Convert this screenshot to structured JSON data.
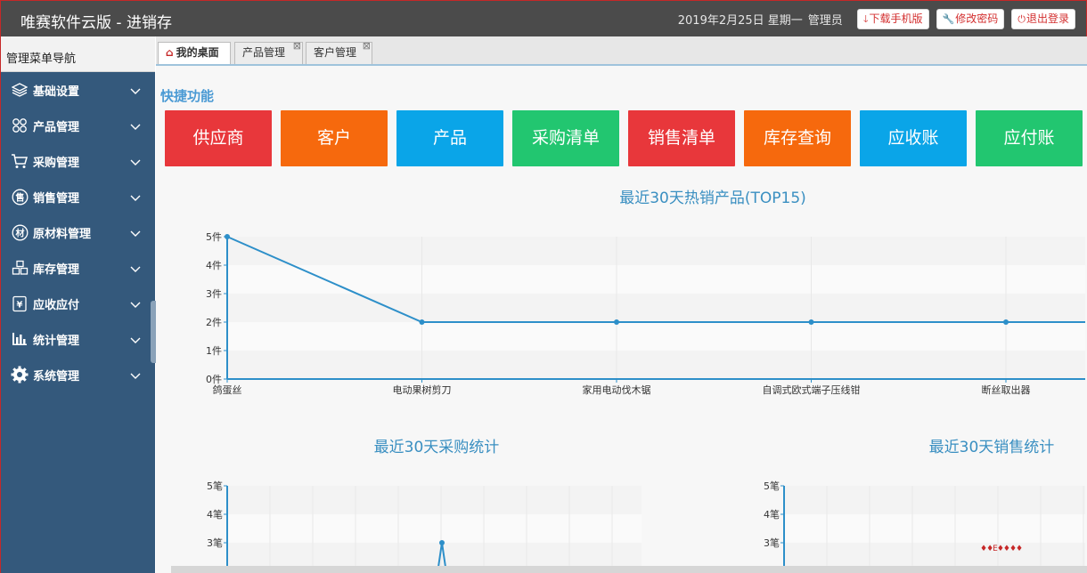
{
  "app": {
    "title": "唯赛软件云版 - 进销存"
  },
  "header": {
    "date": "2019年2月25日 星期一",
    "role": "管理员",
    "buttons": [
      {
        "icon": "download-icon",
        "label": "下载手机版"
      },
      {
        "icon": "wrench-icon",
        "label": "修改密码"
      },
      {
        "icon": "power-icon",
        "label": "退出登录"
      }
    ]
  },
  "sidebar": {
    "title": "管理菜单导航",
    "items": [
      {
        "icon": "layers-icon",
        "label": "基础设置"
      },
      {
        "icon": "grid-icon",
        "label": "产品管理"
      },
      {
        "icon": "cart-icon",
        "label": "采购管理"
      },
      {
        "icon": "sale-icon",
        "label": "销售管理"
      },
      {
        "icon": "material-icon",
        "label": "原材料管理"
      },
      {
        "icon": "boxes-icon",
        "label": "库存管理"
      },
      {
        "icon": "finance-icon",
        "label": "应收应付"
      },
      {
        "icon": "bar-chart-icon",
        "label": "统计管理"
      },
      {
        "icon": "gear-icon",
        "label": "系统管理"
      }
    ]
  },
  "tabs": [
    {
      "label": "我的桌面",
      "active": true
    },
    {
      "label": "产品管理",
      "active": false
    },
    {
      "label": "客户管理",
      "active": false
    }
  ],
  "quick": {
    "title": "快捷功能",
    "buttons": [
      {
        "label": "供应商",
        "color": "#e8373b"
      },
      {
        "label": "客户",
        "color": "#f6690d"
      },
      {
        "label": "产品",
        "color": "#0aa5e8"
      },
      {
        "label": "采购清单",
        "color": "#22c670"
      },
      {
        "label": "销售清单",
        "color": "#e8373b"
      },
      {
        "label": "库存查询",
        "color": "#f6690d"
      },
      {
        "label": "应收账",
        "color": "#0aa5e8"
      },
      {
        "label": "应付账",
        "color": "#22c670"
      }
    ]
  },
  "chart_data": [
    {
      "type": "line",
      "title": "最近30天热销产品(TOP15)",
      "categories": [
        "鸽蛋丝",
        "电动果树剪刀",
        "家用电动伐木锯",
        "自调式欧式端子压线钳",
        "断丝取出器"
      ],
      "values": [
        5,
        2,
        2,
        2,
        2
      ],
      "y_ticks": [
        "0件",
        "1件",
        "2件",
        "3件",
        "4件",
        "5件"
      ],
      "ylim": [
        0,
        5
      ],
      "grid": true,
      "color": "#2d8fc9"
    },
    {
      "type": "line",
      "title": "最近30天采购统计",
      "y_ticks": [
        "3笔",
        "4笔",
        "5笔"
      ],
      "ylim": [
        0,
        5
      ],
      "peak_value": 3,
      "grid": true,
      "color": "#2d8fc9"
    },
    {
      "type": "line",
      "title": "最近30天销售统计",
      "y_ticks": [
        "3笔",
        "4笔",
        "5笔"
      ],
      "ylim": [
        0,
        5
      ],
      "grid": true,
      "color": "#2d8fc9"
    }
  ]
}
